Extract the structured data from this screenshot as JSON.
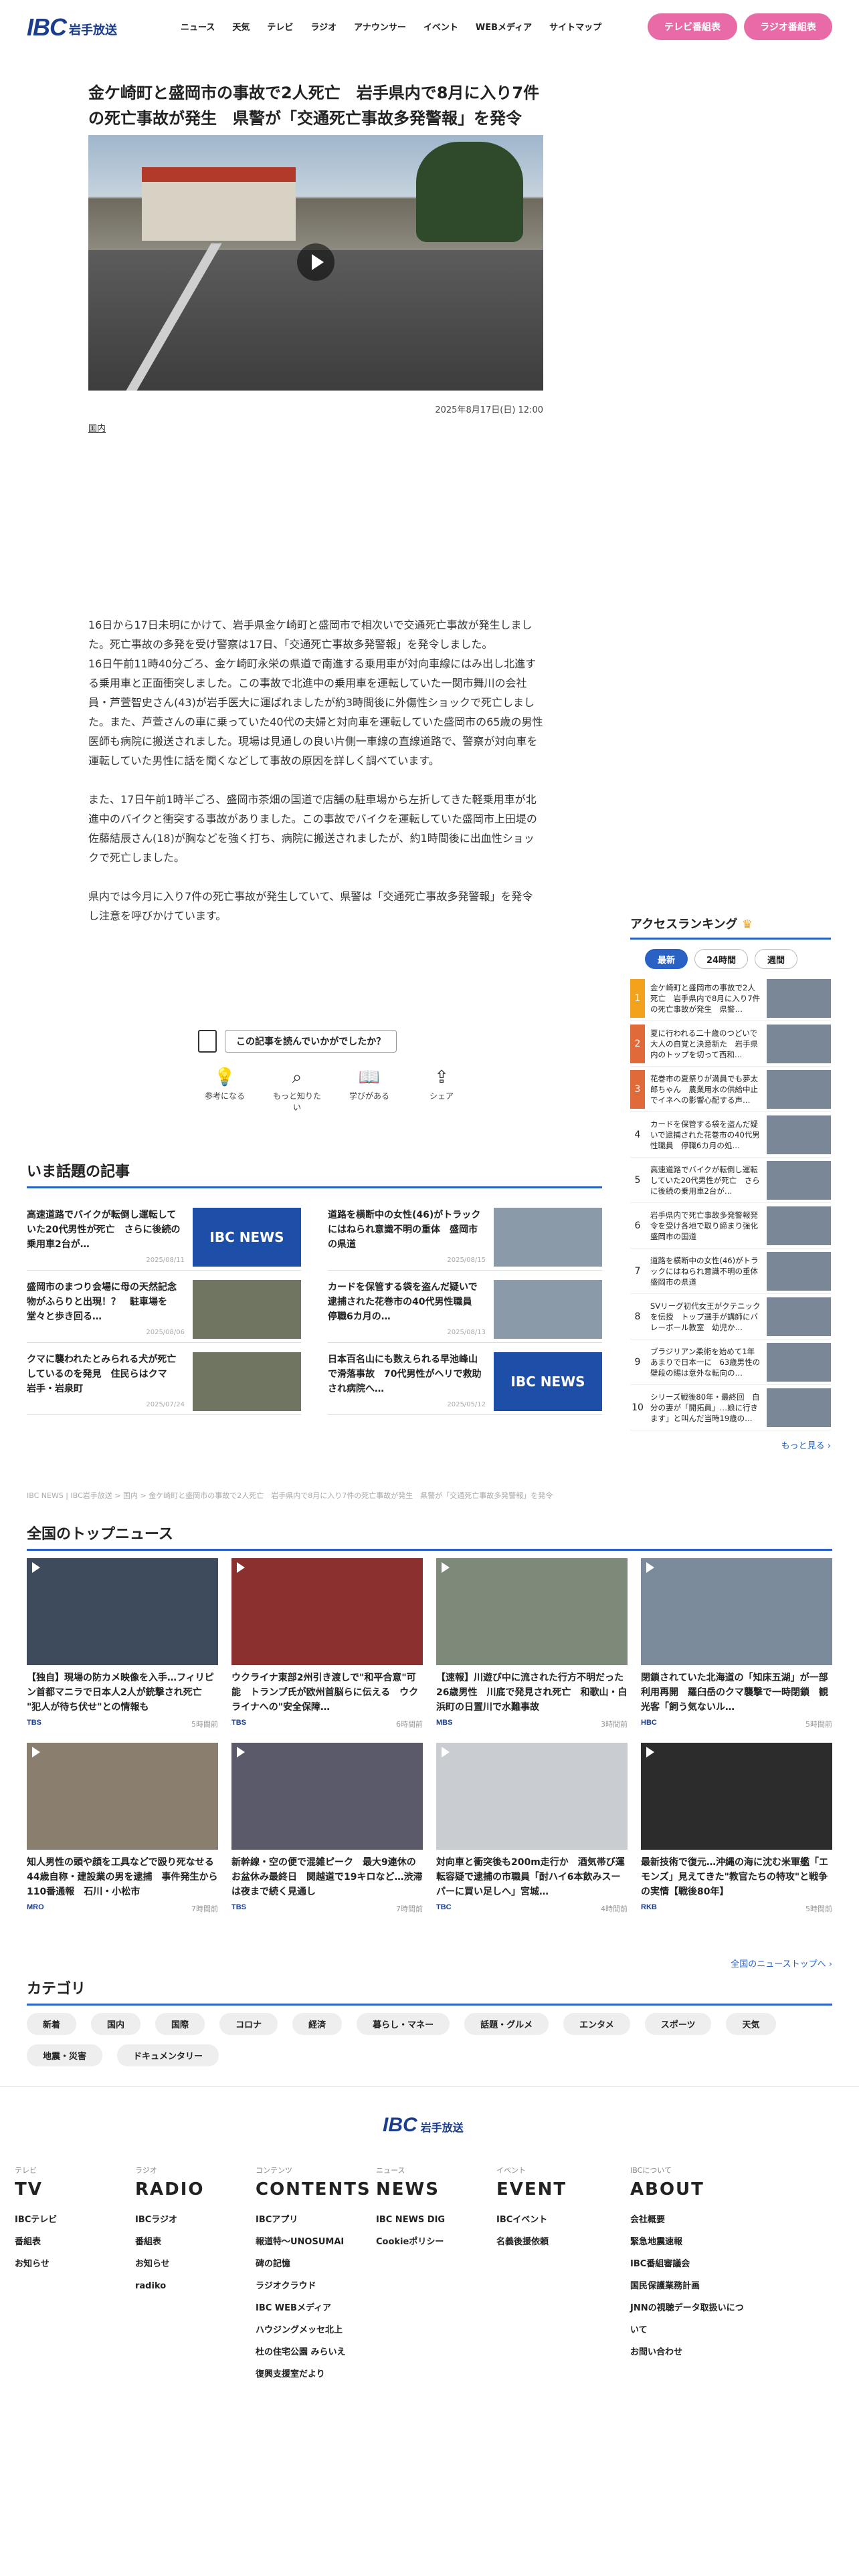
{
  "header": {
    "logo_mark": "IBC",
    "logo_text": "岩手放送",
    "nav": [
      "ニュース",
      "天気",
      "テレビ",
      "ラジオ",
      "アナウンサー",
      "イベント",
      "WEBメディア",
      "サイトマップ"
    ],
    "tv_button": "テレビ番組表",
    "radio_button": "ラジオ番組表",
    "accent": "#e86aa6"
  },
  "article": {
    "title": "金ケ崎町と盛岡市の事故で2人死亡　岩手県内で8月に入り7件の死亡事故が発生　県警が「交通死亡事故多発警報」を発令",
    "date": "2025年8月17日(日) 12:00",
    "category": "国内",
    "paragraphs": [
      "16日から17日未明にかけて、岩手県金ケ崎町と盛岡市で相次いで交通死亡事故が発生しました。死亡事故の多発を受け警察は17日、「交通死亡事故多発警報」を発令しました。\n16日午前11時40分ごろ、金ケ崎町永栄の県道で南進する乗用車が対向車線にはみ出し北進する乗用車と正面衝突しました。この事故で北進中の乗用車を運転していた一関市舞川の会社員・芦萱智史さん(43)が岩手医大に運ばれましたが約3時間後に外傷性ショックで死亡しました。また、芦萱さんの車に乗っていた40代の夫婦と対向車を運転していた盛岡市の65歳の男性医師も病院に搬送されました。現場は見通しの良い片側一車線の直線道路で、警察が対向車を運転していた男性に話を聞くなどして事故の原因を詳しく調べています。",
      "また、17日午前1時半ごろ、盛岡市茶畑の国道で店舗の駐車場から左折してきた軽乗用車が北進中のバイクと衝突する事故がありました。この事故でバイクを運転していた盛岡市上田堤の佐藤結辰さん(18)が胸などを強く打ち、病院に搬送されましたが、約1時間後に出血性ショックで死亡しました。",
      "県内では今月に入り7件の死亡事故が発生していて、県警は「交通死亡事故多発警報」を発令し注意を呼びかけています。"
    ],
    "question_button": "この記事を読んでいかがでしたか？",
    "reactions": [
      "参考になる",
      "もっと知りたい",
      "学びがある",
      "シェア"
    ]
  },
  "trending": {
    "title": "いま話題の記事",
    "thumb_label": "IBC NEWS",
    "items": [
      {
        "title": "高速道路でバイクが転倒し運転していた20代男性が死亡　さらに後続の乗用車2台が…",
        "date": "2025/08/11"
      },
      {
        "title": "道路を横断中の女性(46)がトラックにはねられ意識不明の重体　盛岡市の県道",
        "date": "2025/08/15"
      },
      {
        "title": "盛岡市のまつり会場に母の天然記念物がふらりと出現！？　駐車場を堂々と歩き回る…",
        "date": "2025/08/06"
      },
      {
        "title": "カードを保管する袋を盗んだ疑いで逮捕された花巻市の40代男性職員　停職6カ月の…",
        "date": "2025/08/13"
      },
      {
        "title": "クマに襲われたとみられる犬が死亡しているのを発見　住民らはクマ　岩手・岩泉町",
        "date": "2025/07/24"
      },
      {
        "title": "日本百名山にも数えられる早池峰山で滑落事故　70代男性がヘリで救助され病院へ…",
        "date": "2025/05/12"
      }
    ]
  },
  "breadcrumb": "IBC NEWS | IBC岩手放送 > 国内 > 金ケ崎町と盛岡市の事故で2人死亡　岩手県内で8月に入り7件の死亡事故が発生　県警が「交通死亡事故多発警報」を発令",
  "ranking": {
    "title": "アクセスランキング",
    "tabs": [
      "最新",
      "24時間",
      "週間"
    ],
    "items": [
      {
        "rank": "1",
        "title": "金ケ崎町と盛岡市の事故で2人死亡　岩手県内で8月に入り7件の死亡事故が発生　県警…"
      },
      {
        "rank": "2",
        "title": "夏に行われる二十歳のつどいで大人の自覚と決意新た　岩手県内のトップを切って西和…"
      },
      {
        "rank": "3",
        "title": "花巻市の夏祭りが満員でも夢太郎ちゃん　農業用水の供給中止でイネへの影響心配する声…"
      },
      {
        "rank": "4",
        "title": "カードを保管する袋を盗んだ疑いで逮捕された花巻市の40代男性職員　停職6カ月の処…"
      },
      {
        "rank": "5",
        "title": "高速道路でバイクが転倒し運転していた20代男性が死亡　さらに後続の乗用車2台が…"
      },
      {
        "rank": "6",
        "title": "岩手県内で死亡事故多発警報発令を受け各地で取り締まり強化　盛岡市の国道"
      },
      {
        "rank": "7",
        "title": "道路を横断中の女性(46)がトラックにはねられ意識不明の重体　盛岡市の県道"
      },
      {
        "rank": "8",
        "title": "SVリーグ初代女王がクテニックを伝授　トップ選手が講師にバレーボール教室　幼児か…"
      },
      {
        "rank": "9",
        "title": "ブラジリアン柔術を始めて1年あまりで日本一に　63歳男性の壁段の賜は意外な転向の…"
      },
      {
        "rank": "10",
        "title": "シリーズ戦後80年・最終回　自分の妻が「開拓員」…娘に行きます」と叫んだ当時19歳の…"
      }
    ],
    "rank_colors": [
      "#f2a31b",
      "#e06a3a",
      "#e06a3a"
    ],
    "more": "もっと見る"
  },
  "national": {
    "title": "全国のトップニュース",
    "items": [
      {
        "title": "【独自】現場の防カメ映像を入手…フィリピン首都マニラで日本人2人が銃撃され死亡 \"犯人が待ち伏せ\"との情報も",
        "source": "TBS",
        "age": "5時間前"
      },
      {
        "title": "ウクライナ東部2州引き渡しで\"和平合意\"可能　トランプ氏が欧州首脳らに伝える　ウクライナへの\"安全保障…",
        "source": "TBS",
        "age": "6時間前"
      },
      {
        "title": "【速報】川遊び中に流された行方不明だった26歳男性　川底で発見され死亡　和歌山・白浜町の日置川で水難事故",
        "source": "MBS",
        "age": "3時間前"
      },
      {
        "title": "閉鎖されていた北海道の「知床五湖」が一部利用再開　羅臼岳のクマ襲撃で一時閉鎖　観光客「飼う気ないル…",
        "source": "HBC",
        "age": "5時間前"
      },
      {
        "title": "知人男性の頭や顔を工具などで殴り死なせる　44歳自称・建設業の男を逮捕　事件発生から110番通報　石川・小松市",
        "source": "MRO",
        "age": "7時間前"
      },
      {
        "title": "新幹線・空の便で混雑ピーク　最大9連休のお盆休み最終日　関越道で19キロなど…渋滞は夜まで続く見通し",
        "source": "TBS",
        "age": "7時間前"
      },
      {
        "title": "対向車と衝突後も200m走行か　酒気帯び運転容疑で逮捕の市職員「酎ハイ6本飲みスーパーに買い足しへ」宮城…",
        "source": "TBC",
        "age": "4時間前"
      },
      {
        "title": "最新技術で復元…沖縄の海に沈む米軍艦「エモンズ」見えてきた\"教官たちの特攻\"と戦争の実情【戦後80年】",
        "source": "RKB",
        "age": "5時間前"
      }
    ],
    "all_link": "全国のニューストップへ"
  },
  "categories": {
    "title": "カテゴリ",
    "chips": [
      "新着",
      "国内",
      "国際",
      "コロナ",
      "経済",
      "暮らし・マネー",
      "話題・グルメ",
      "エンタメ",
      "スポーツ",
      "天気",
      "地震・災害",
      "ドキュメンタリー"
    ]
  },
  "footer": {
    "columns": [
      {
        "small": "テレビ",
        "big": "TV",
        "links": [
          "IBCテレビ",
          "番組表",
          "お知らせ"
        ]
      },
      {
        "small": "ラジオ",
        "big": "RADIO",
        "links": [
          "IBCラジオ",
          "番組表",
          "お知らせ",
          "radiko"
        ]
      },
      {
        "small": "コンテンツ",
        "big": "CONTENTS",
        "links": [
          "IBCアプリ",
          "報道特～UNOSUMAI",
          "碑の記憶",
          "ラジオクラウド",
          "IBC WEBメディア",
          "ハウジングメッセ北上",
          "杜の住宅公園 みらいえ",
          "復興支援室だより"
        ]
      },
      {
        "small": "ニュース",
        "big": "NEWS",
        "links": [
          "IBC NEWS DIG",
          "Cookieポリシー"
        ]
      },
      {
        "small": "イベント",
        "big": "EVENT",
        "links": [
          "IBCイベント",
          "名義後援依頼"
        ]
      },
      {
        "small": "IBCについて",
        "big": "ABOUT",
        "links": [
          "会社概要",
          "緊急地震速報",
          "IBC番組審議会",
          "国民保護業務計画",
          "JNNの視聴データ取扱いについて",
          "お問い合わせ"
        ]
      }
    ]
  }
}
